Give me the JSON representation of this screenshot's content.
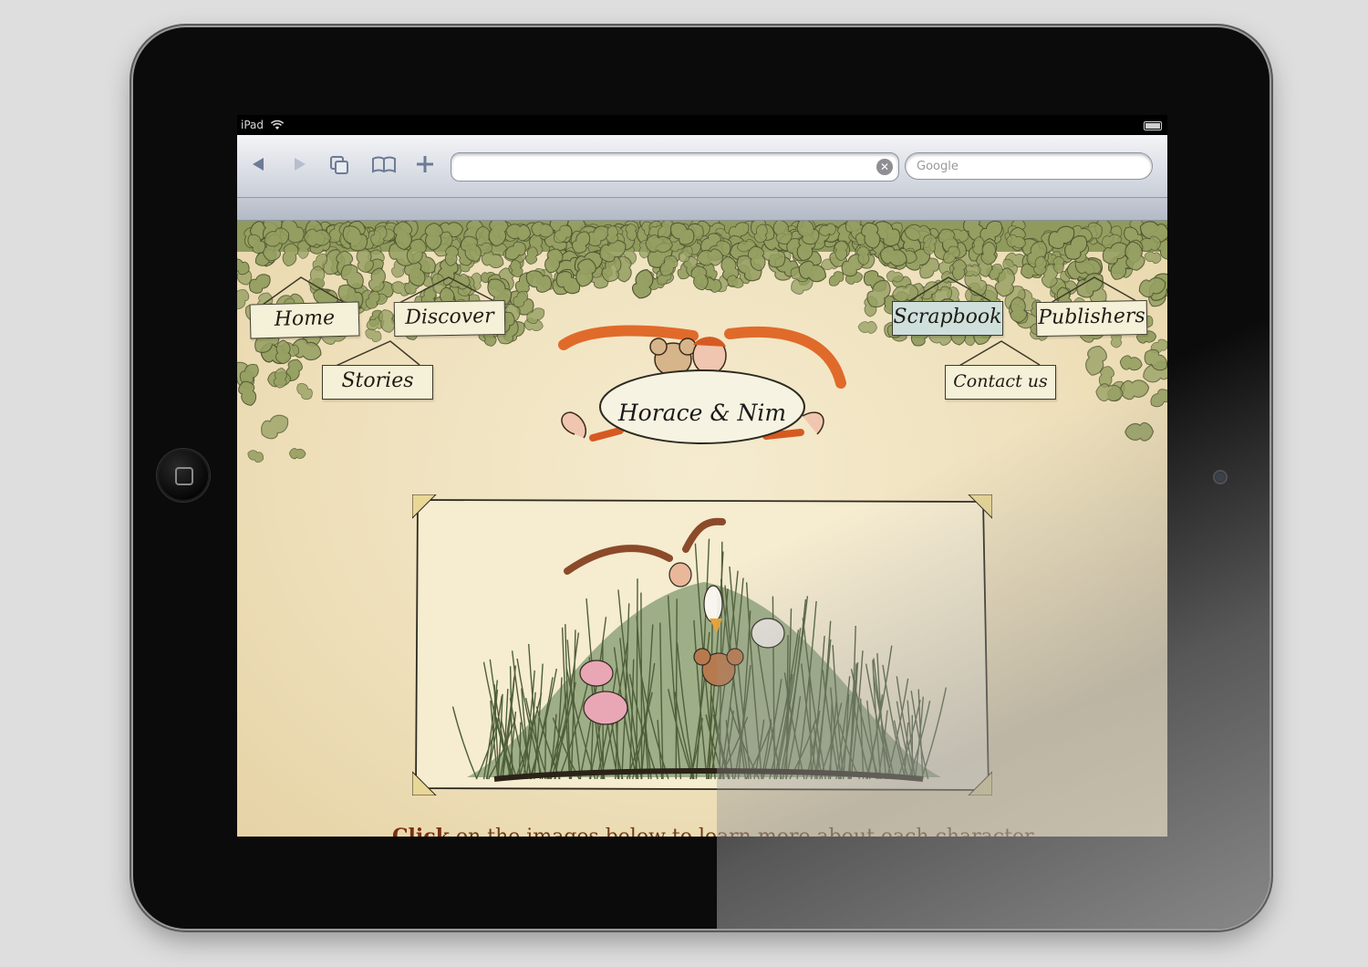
{
  "device": {
    "status_bar": {
      "carrier": "iPad"
    }
  },
  "browser": {
    "back_icon": "back-arrow-icon",
    "forward_icon": "forward-arrow-icon",
    "pages_icon": "pages-icon",
    "bookmarks_icon": "bookmarks-icon",
    "add_icon": "plus-icon",
    "url": {
      "value": ""
    },
    "search": {
      "placeholder": "Google"
    }
  },
  "site": {
    "nav": [
      {
        "label": "Home",
        "active": false
      },
      {
        "label": "Discover",
        "active": false
      },
      {
        "label": "Stories",
        "active": false
      },
      {
        "label": "Scrapbook",
        "active": true
      },
      {
        "label": "Publishers",
        "active": false
      },
      {
        "label": "Contact us",
        "active": false
      }
    ],
    "logo_text": "Horace & Nim",
    "caption": {
      "strong": "Click",
      "rest": " on the images below to learn more about each character"
    },
    "colors": {
      "paper": "#f2e6c4",
      "leaf": "#8a9558",
      "active_sign": "#cfe0dc",
      "caption": "#6d3b14"
    }
  }
}
